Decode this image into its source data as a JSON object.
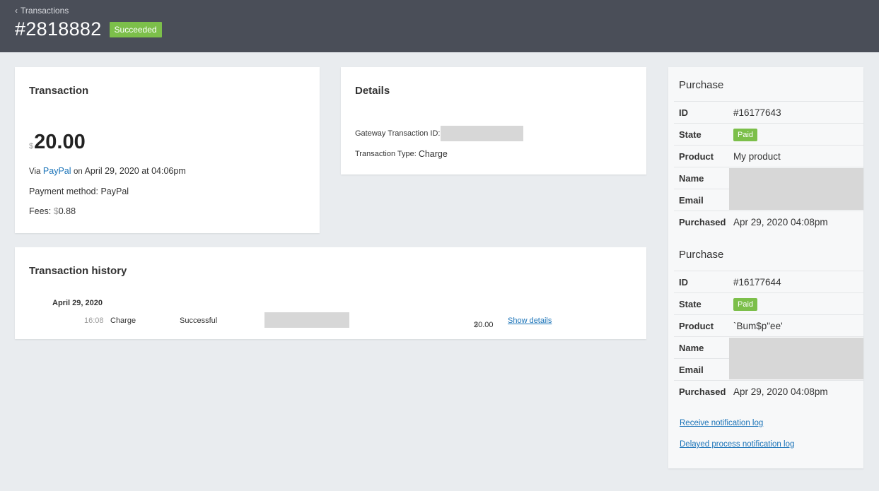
{
  "header": {
    "back_label": "Transactions",
    "transaction_id": "#2818882",
    "status": "Succeeded"
  },
  "transaction": {
    "title": "Transaction",
    "currency_symbol": "$",
    "amount": "20.00",
    "via_prefix": "Via",
    "gateway": "PayPal",
    "on_text": "on",
    "date": "April 29, 2020 at 04:06pm",
    "payment_method": "Payment method: PayPal",
    "fees_label": "Fees:",
    "fees_value": "0.88"
  },
  "details": {
    "title": "Details",
    "gateway_txn_label": "Gateway Transaction ID:",
    "txn_type_label": "Transaction Type:",
    "txn_type_value": "Charge"
  },
  "history": {
    "title": "Transaction history",
    "date": "April 29, 2020",
    "rows": [
      {
        "time": "16:08",
        "type": "Charge",
        "status": "Successful",
        "currency_symbol": "$",
        "amount": "20.00",
        "action": "Show details"
      }
    ]
  },
  "purchases": [
    {
      "title": "Purchase",
      "labels": {
        "id": "ID",
        "state": "State",
        "product": "Product",
        "name": "Name",
        "email": "Email",
        "purchased": "Purchased"
      },
      "id": "#16177643",
      "state": "Paid",
      "product": "My product",
      "purchased": "Apr 29, 2020 04:08pm"
    },
    {
      "title": "Purchase",
      "labels": {
        "id": "ID",
        "state": "State",
        "product": "Product",
        "name": "Name",
        "email": "Email",
        "purchased": "Purchased"
      },
      "id": "#16177644",
      "state": "Paid",
      "product": "`Bum$p\"ee'",
      "purchased": "Apr 29, 2020 04:08pm"
    }
  ],
  "logs": {
    "receive": "Receive notification log",
    "delayed": "Delayed process notification log"
  },
  "colors": {
    "header_bg": "#4a4e58",
    "success_green": "#7cbf4a",
    "link_blue": "#1a73b8",
    "page_bg": "#e9ecef"
  }
}
